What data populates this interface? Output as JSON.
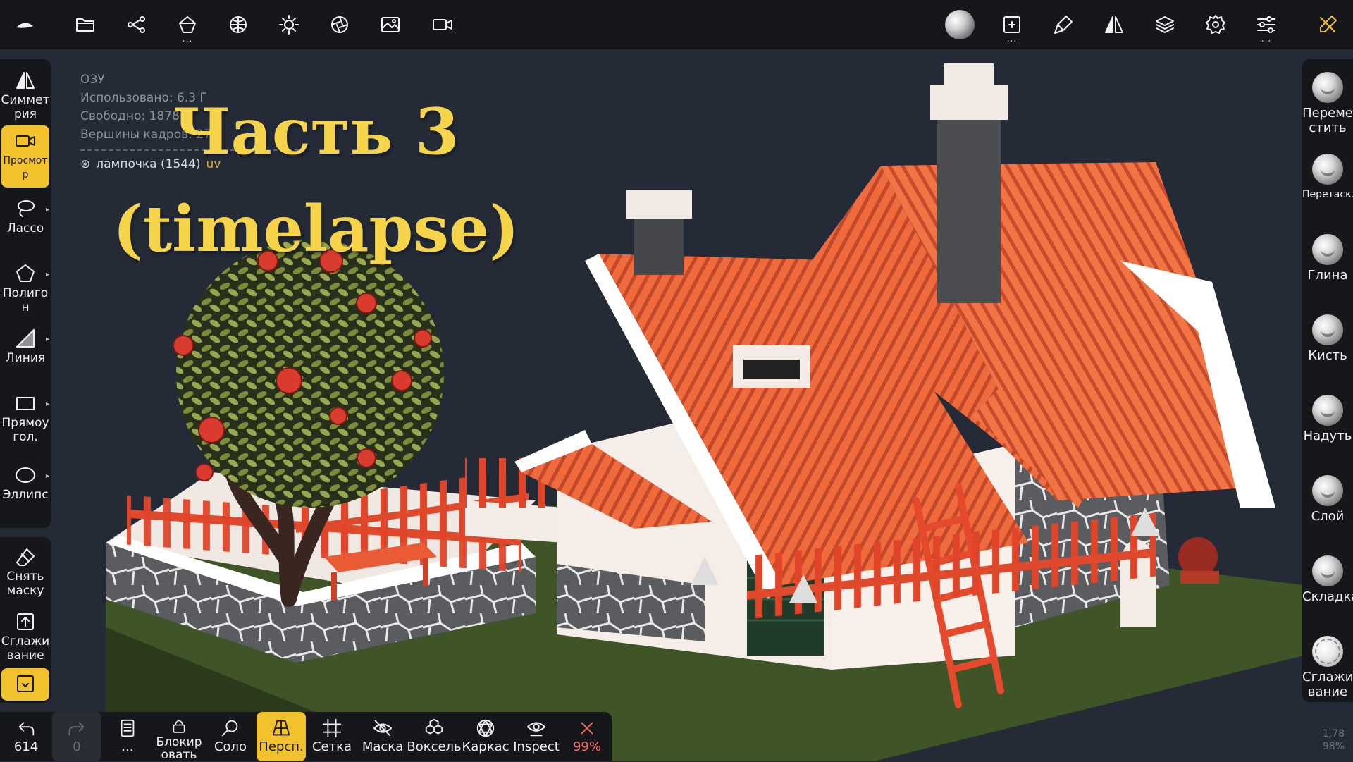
{
  "topbar": {
    "icons": [
      "nomad-logo-icon",
      "folder-icon",
      "scene-graph-icon",
      "primitive-icon",
      "material-icon",
      "light-icon",
      "postprocess-icon",
      "background-image-icon",
      "camera-icon",
      "material-ball-icon",
      "texture-paint-icon",
      "paint-brush-icon",
      "symmetry-icon",
      "layers-icon",
      "settings-icon",
      "sliders-icon",
      "tools-icon"
    ]
  },
  "left_tools": [
    {
      "label": "Симмет рия",
      "icon": "symmetry-icon"
    },
    {
      "label": "Просмотр",
      "icon": "camera-icon"
    },
    {
      "label": "Лассо",
      "icon": "lasso-icon"
    },
    {
      "label": "Полигон",
      "icon": "polygon-icon"
    },
    {
      "label": "Линия",
      "icon": "line-icon"
    },
    {
      "label": "Прямоу гол.",
      "icon": "rectangle-icon"
    },
    {
      "label": "Эллипс",
      "icon": "ellipse-icon"
    }
  ],
  "left_tools_2": [
    {
      "label": "Снять маску",
      "icon": "eraser-icon"
    },
    {
      "label": "Сглажи вание",
      "icon": "smooth-icon"
    },
    {
      "label": "",
      "icon": "extract-icon"
    }
  ],
  "right_brushes": [
    {
      "label": "Переме стить"
    },
    {
      "label": "Перетаск."
    },
    {
      "label": "Глина"
    },
    {
      "label": "Кисть"
    },
    {
      "label": "Надуть"
    },
    {
      "label": "Слой"
    },
    {
      "label": "Складка"
    },
    {
      "label": "Сглажи вание"
    }
  ],
  "bottombar": {
    "undo_count": "614",
    "redo_count": "0",
    "more": "...",
    "lock": "Блокир овать",
    "solo": "Соло",
    "persp": "Персп.",
    "grid": "Сетка",
    "mask": "Маска",
    "voxel": "Воксель",
    "wireframe": "Каркас",
    "inspect": "Inspect",
    "opacity": "99%"
  },
  "info": {
    "title": "ОЗУ",
    "used": "Использовано: 6.3 Г",
    "free": "Свободно: 1878 М",
    "vertices": "Вершины кадров: 279",
    "mesh_name": "лампочка (1544)",
    "mesh_uv": "uv"
  },
  "headline": {
    "line1": "Часть 3",
    "line2": "(timelapse)"
  },
  "corner": {
    "line1": "1.78",
    "line2": "98%"
  },
  "colors": {
    "accent": "#f2c12e",
    "panel": "#15171b",
    "viewport_bg": "#242b37",
    "headline": "#f5d44a",
    "roof": "#f06a3e"
  }
}
